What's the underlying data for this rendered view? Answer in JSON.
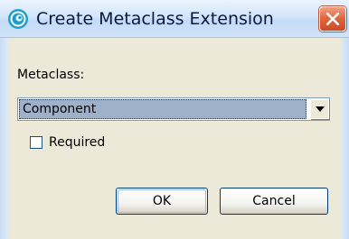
{
  "window": {
    "title": "Create Metaclass Extension",
    "app_icon": "eclipse-swirl-icon",
    "close_icon": "close-x-icon",
    "colors": {
      "titlebar": "#d3e6fa",
      "close_button": "#e06742",
      "selection": "#9fb1c8"
    }
  },
  "form": {
    "metaclass_label": "Metaclass:",
    "metaclass_value": "Component",
    "required_label": "Required",
    "required_checked": false
  },
  "buttons": {
    "ok_label": "OK",
    "cancel_label": "Cancel"
  }
}
